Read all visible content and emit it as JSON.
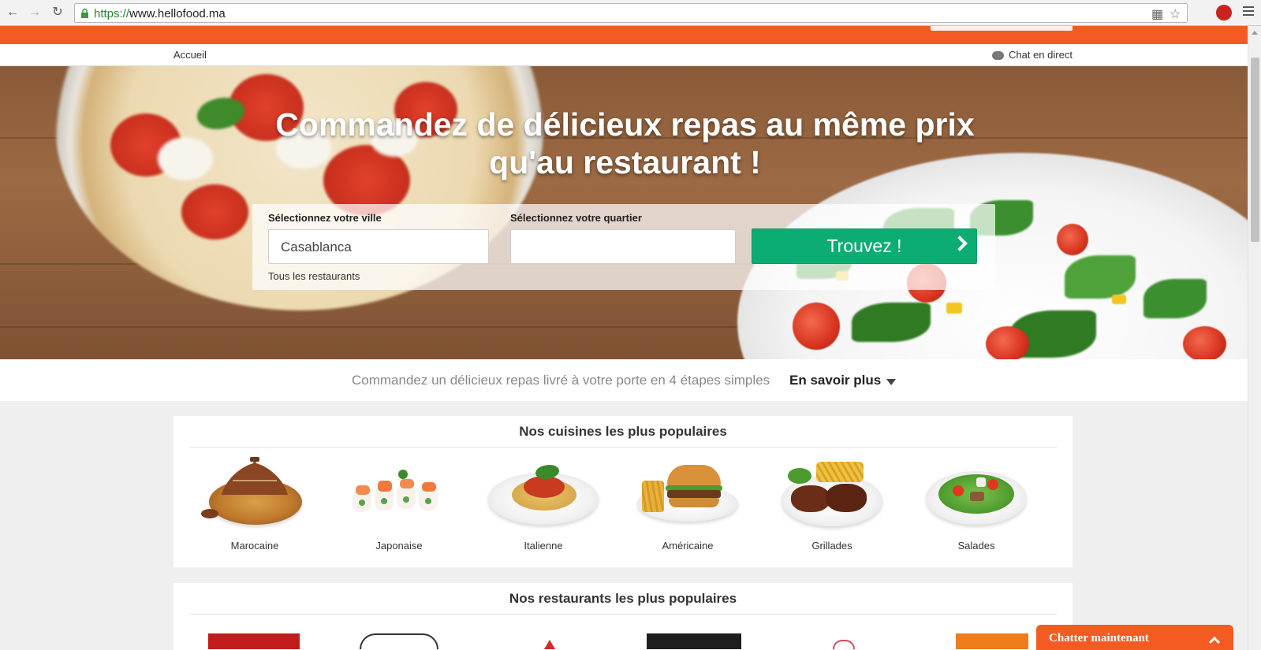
{
  "browser": {
    "url_scheme": "https://",
    "url_host": "www.hellofood.ma"
  },
  "subnav": {
    "home": "Accueil",
    "chat": "Chat en direct"
  },
  "hero": {
    "title": "Commandez de délicieux repas au même prix qu'au restaurant !",
    "city_label": "Sélectionnez votre ville",
    "city_value": "Casablanca",
    "district_label": "Sélectionnez votre quartier",
    "district_value": "",
    "all_restaurants": "Tous les restaurants",
    "find_button": "Trouvez !"
  },
  "steps": {
    "text": "Commandez un délicieux repas livré à votre porte en 4 étapes simples",
    "more": "En savoir plus"
  },
  "cuisines": {
    "title": "Nos cuisines les plus populaires",
    "items": [
      {
        "name": "Marocaine"
      },
      {
        "name": "Japonaise"
      },
      {
        "name": "Italienne"
      },
      {
        "name": "Américaine"
      },
      {
        "name": "Grillades"
      },
      {
        "name": "Salades"
      }
    ]
  },
  "restaurants": {
    "title": "Nos restaurants les plus populaires"
  },
  "chat_widget": {
    "label": "Chatter maintenant"
  },
  "colors": {
    "brand_orange": "#f45b23",
    "button_green": "#0cad72"
  }
}
